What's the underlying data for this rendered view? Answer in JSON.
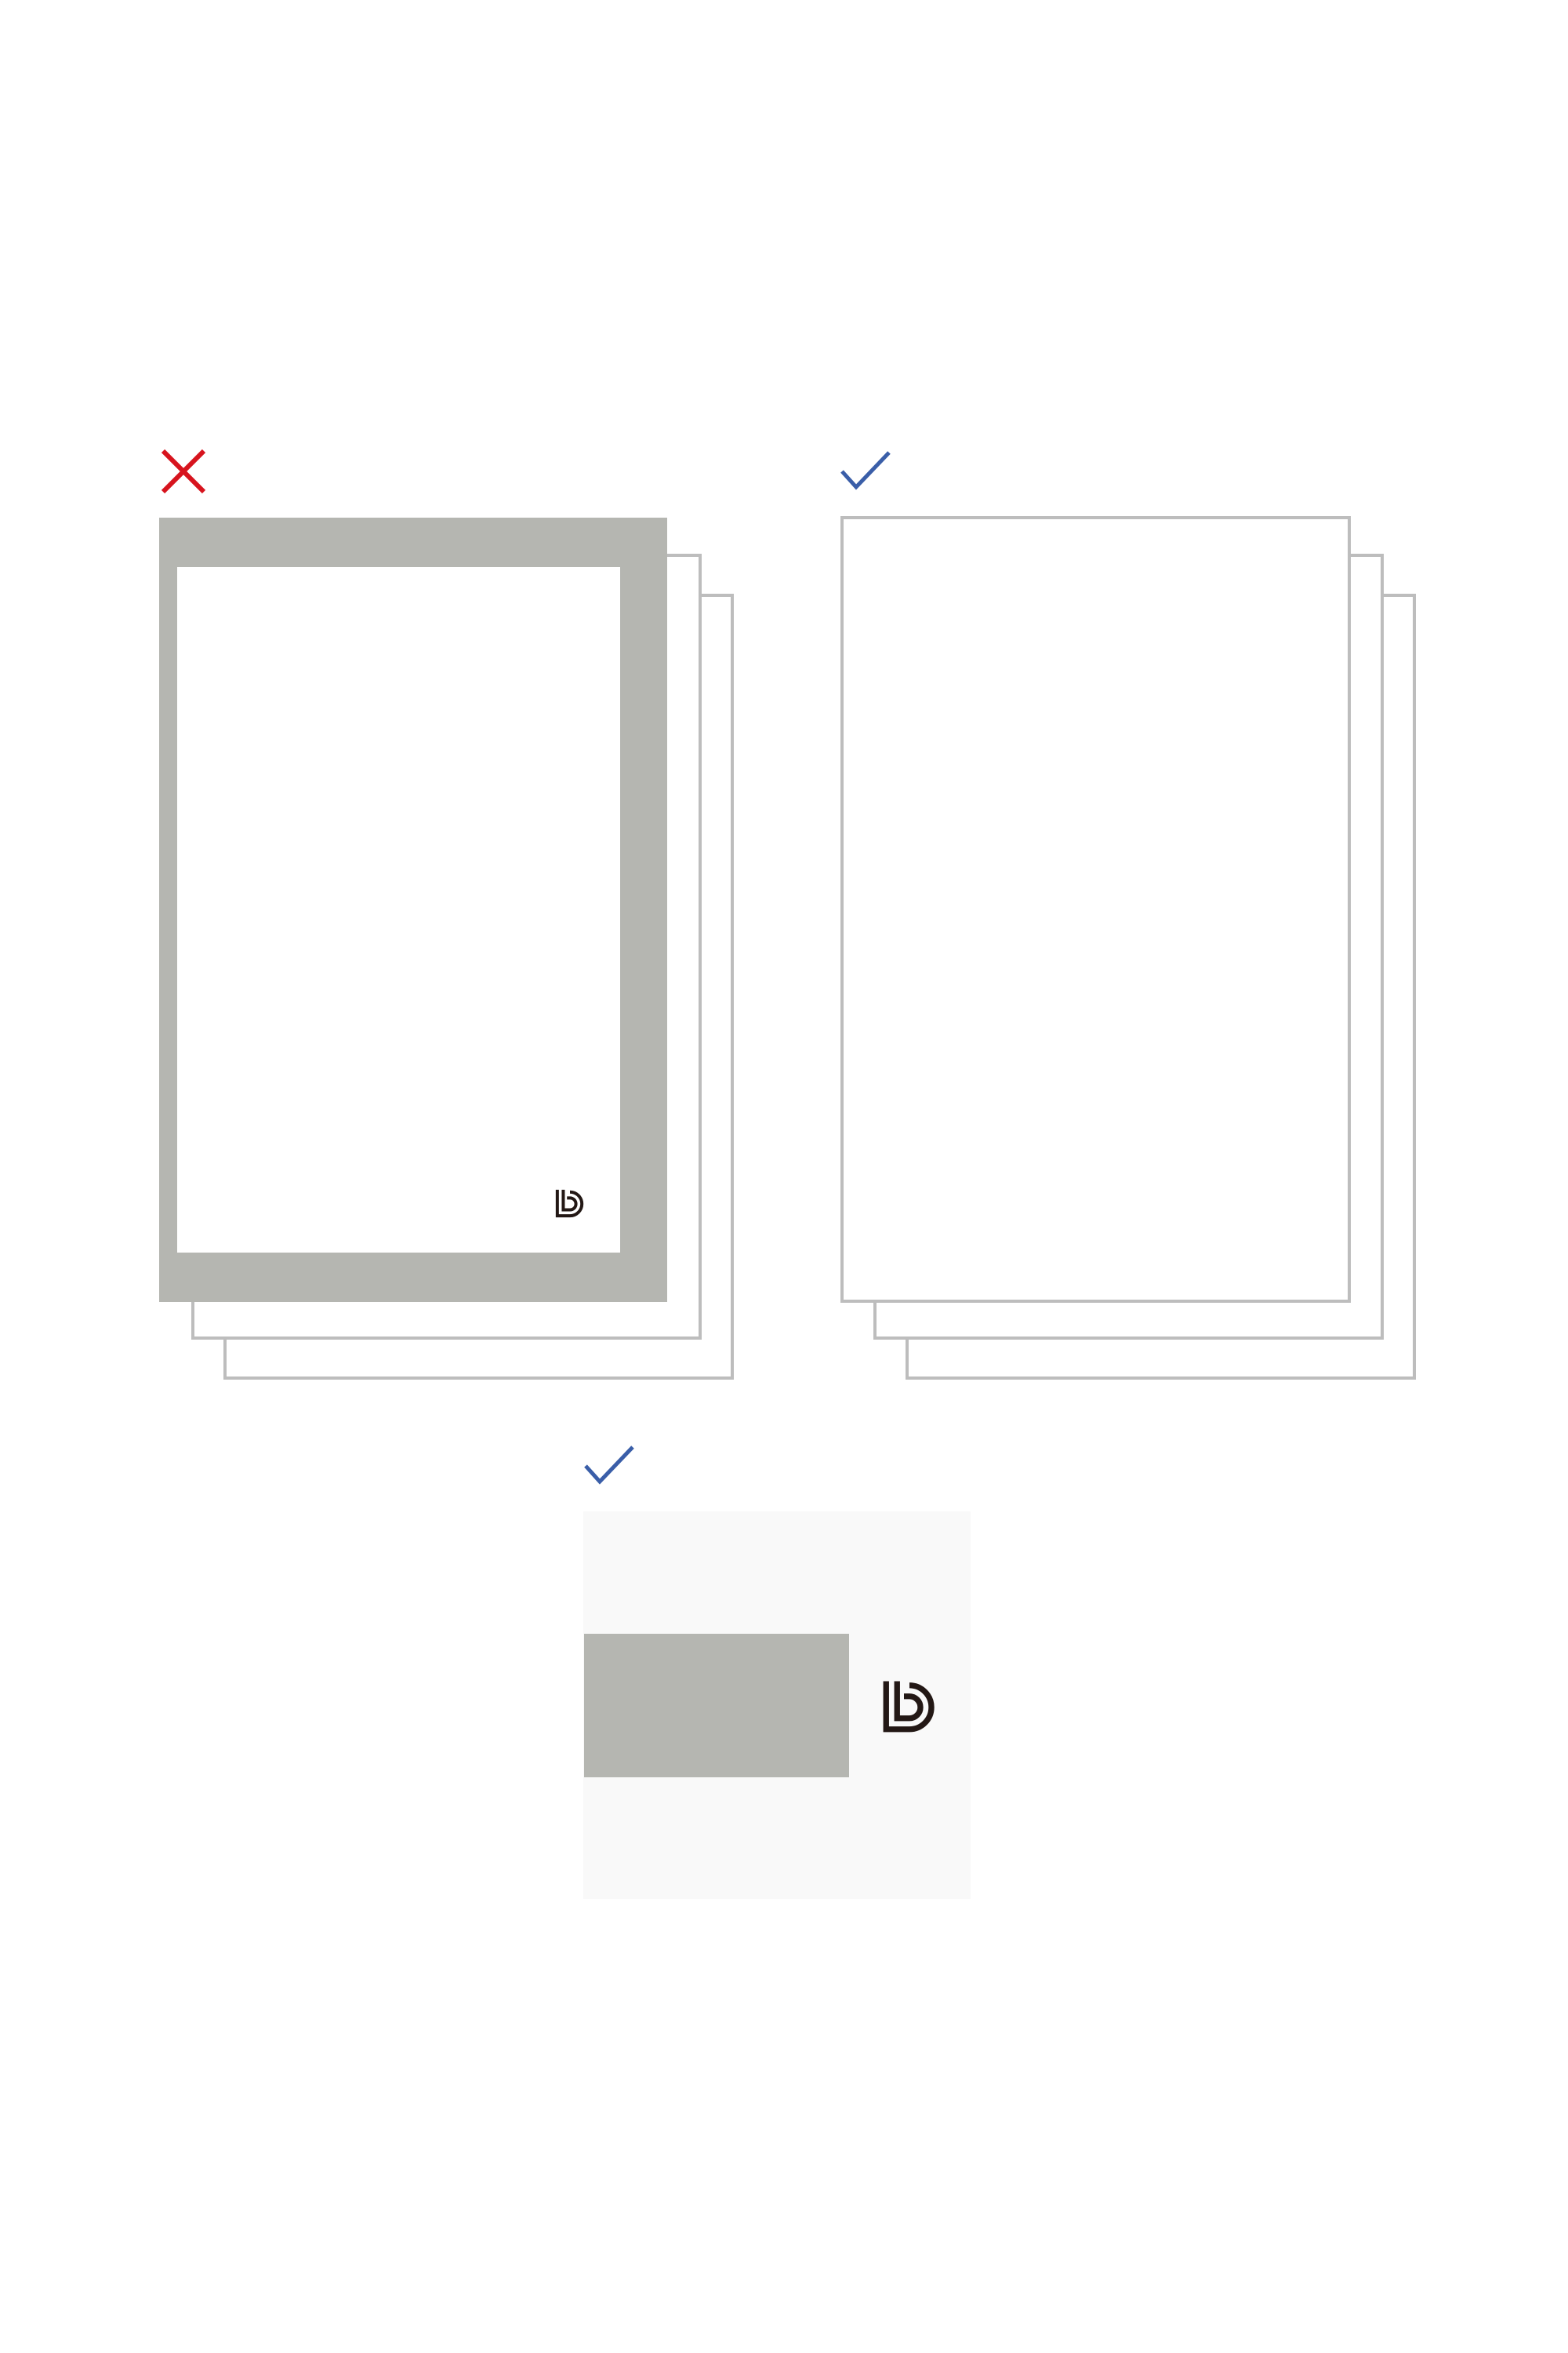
{
  "diagram": {
    "panels": [
      {
        "id": "incorrect-stack",
        "verdict": "incorrect",
        "verdict_icon": "cross-icon",
        "front_sheet": "gray-frame-with-logo",
        "back_sheets": 2
      },
      {
        "id": "correct-stack",
        "verdict": "correct",
        "verdict_icon": "check-icon",
        "front_sheet": "plain-white",
        "back_sheets": 2
      },
      {
        "id": "correct-swatch",
        "verdict": "correct",
        "verdict_icon": "check-icon",
        "content": "gray-block-with-logo"
      }
    ],
    "colors": {
      "incorrect": "#d7141e",
      "correct": "#3a5ea8",
      "frame_gray": "#b5b6b1",
      "outline_gray": "#bdbdbd",
      "swatch_bg": "#f9f9f9",
      "logo": "#231815"
    },
    "logo_icon": "ld-monogram-icon"
  }
}
